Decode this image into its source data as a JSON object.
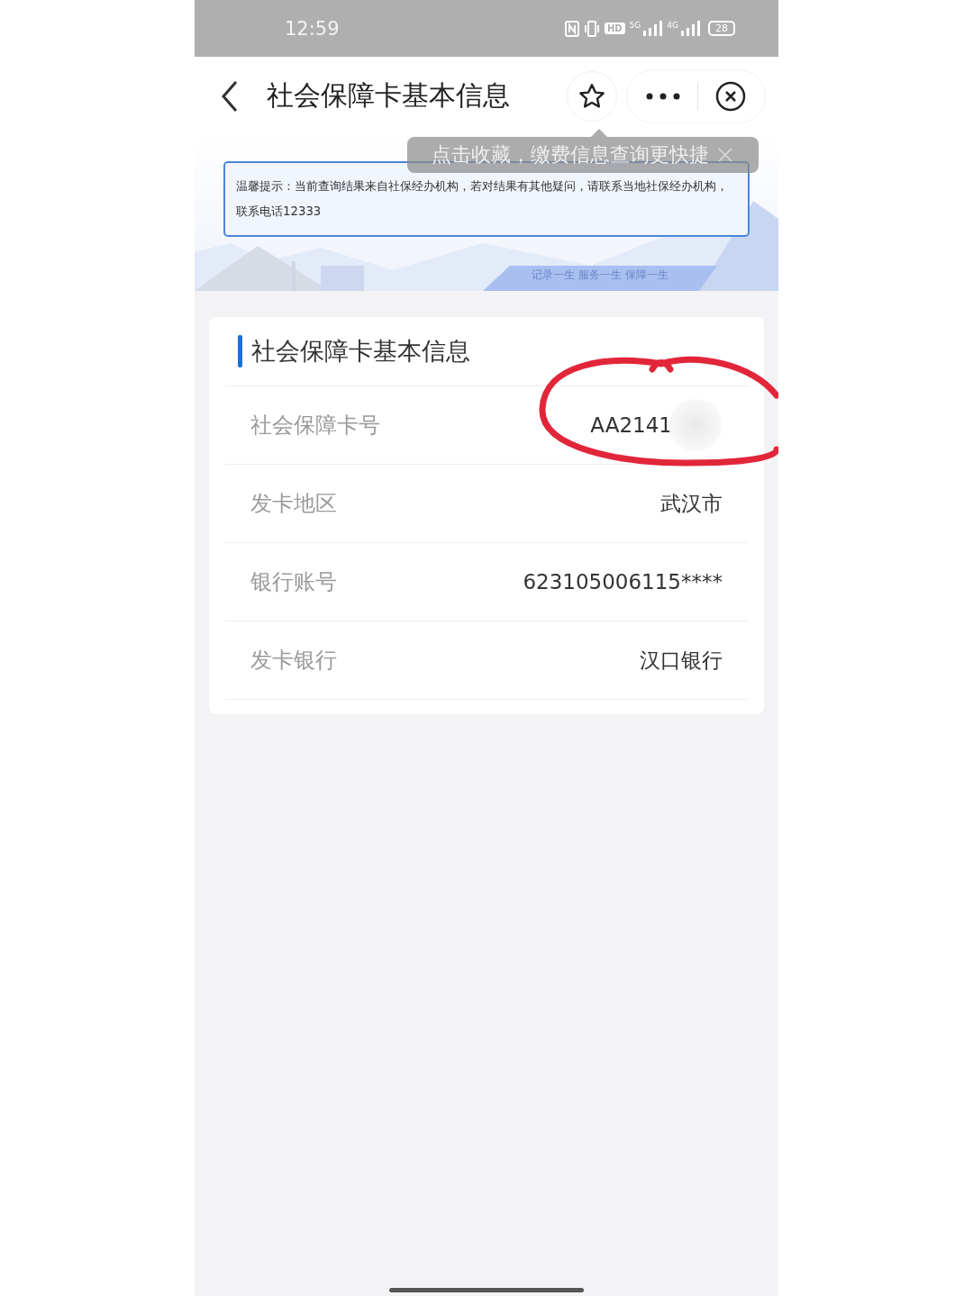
{
  "status_bar": {
    "time": "12:59",
    "hd": "HD",
    "signal_1": "5G",
    "signal_2": "4G",
    "battery": "28"
  },
  "nav": {
    "title": "社会保障卡基本信息"
  },
  "tooltip": {
    "text": "点击收藏，缴费信息查询更快捷"
  },
  "notice": {
    "text": "温馨提示：当前查询结果来自社保经办机构，若对结果有其他疑问，请联系当地社保经办机构，联系电话12333"
  },
  "banner": {
    "slogan": "记录一生 服务一生 保障一生"
  },
  "card": {
    "title": "社会保障卡基本信息",
    "rows": [
      {
        "label": "社会保障卡号",
        "value": "AA2141",
        "redacted": true,
        "circled": true
      },
      {
        "label": "发卡地区",
        "value": "武汉市",
        "redacted": false,
        "circled": false
      },
      {
        "label": "银行账号",
        "value": "623105006115****",
        "redacted": false,
        "circled": false
      },
      {
        "label": "发卡银行",
        "value": "汉口银行",
        "redacted": false,
        "circled": false
      }
    ]
  }
}
